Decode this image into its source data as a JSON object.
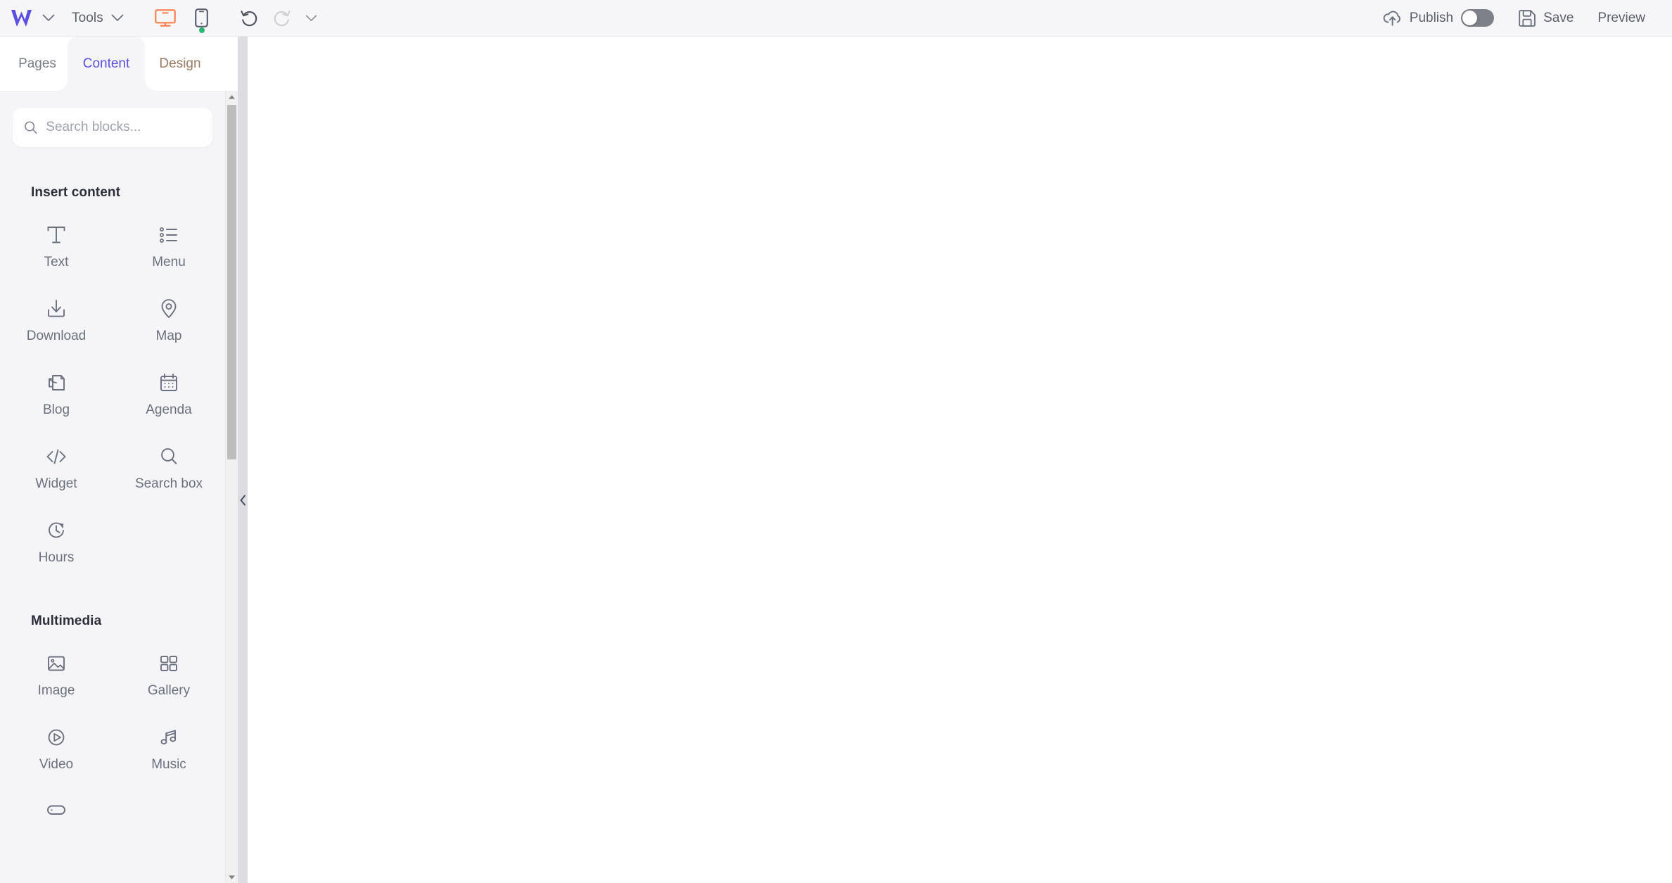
{
  "app": {
    "logo_name": "webnode-logo",
    "accent_purple": "#5b4fe0",
    "accent_orange": "#fa7f4b",
    "status_green": "#2bb673",
    "text_gray": "#5b5f6b"
  },
  "topbar": {
    "logo_chevron_icon": "chevron-down-icon",
    "tools_label": "Tools",
    "tools_chevron_icon": "chevron-down-icon",
    "desktop_view_icon": "desktop-monitor-icon",
    "mobile_view_icon": "mobile-phone-icon",
    "mobile_status_dot": "green-status-dot",
    "undo_icon": "undo-arrow-icon",
    "redo_icon": "redo-arrow-icon",
    "history_chevron_icon": "chevron-down-icon",
    "publish_icon": "cloud-upload-icon",
    "publish_label": "Publish",
    "publish_toggle_state": "off",
    "save_icon": "floppy-disk-save-icon",
    "save_label": "Save",
    "preview_label": "Preview"
  },
  "panel": {
    "tabs": [
      {
        "label": "Pages",
        "active": false
      },
      {
        "label": "Content",
        "active": true
      },
      {
        "label": "Design",
        "active": false
      }
    ],
    "search": {
      "icon": "search-icon",
      "placeholder": "Search blocks...",
      "value": ""
    },
    "sections": [
      {
        "title": "Insert content",
        "blocks": [
          {
            "label": "Text",
            "icon": "text-t-icon"
          },
          {
            "label": "Menu",
            "icon": "bullet-list-menu-icon"
          },
          {
            "label": "Download",
            "icon": "download-tray-icon"
          },
          {
            "label": "Map",
            "icon": "map-pin-icon"
          },
          {
            "label": "Blog",
            "icon": "blog-page-icon"
          },
          {
            "label": "Agenda",
            "icon": "calendar-icon"
          },
          {
            "label": "Widget",
            "icon": "code-brackets-icon"
          },
          {
            "label": "Search box",
            "icon": "magnifier-icon"
          },
          {
            "label": "Hours",
            "icon": "clock-icon"
          }
        ]
      },
      {
        "title": "Multimedia",
        "blocks": [
          {
            "label": "Image",
            "icon": "picture-icon"
          },
          {
            "label": "Gallery",
            "icon": "grid-squares-icon"
          },
          {
            "label": "Video",
            "icon": "play-circle-icon"
          },
          {
            "label": "Music",
            "icon": "music-note-icon"
          },
          {
            "label": "",
            "icon": "button-pill-icon"
          }
        ]
      }
    ],
    "scrollbar": {
      "up_arrow_icon": "scroll-up-arrow-icon",
      "down_arrow_icon": "scroll-down-arrow-icon"
    },
    "collapse_icon": "chevron-left-icon"
  }
}
